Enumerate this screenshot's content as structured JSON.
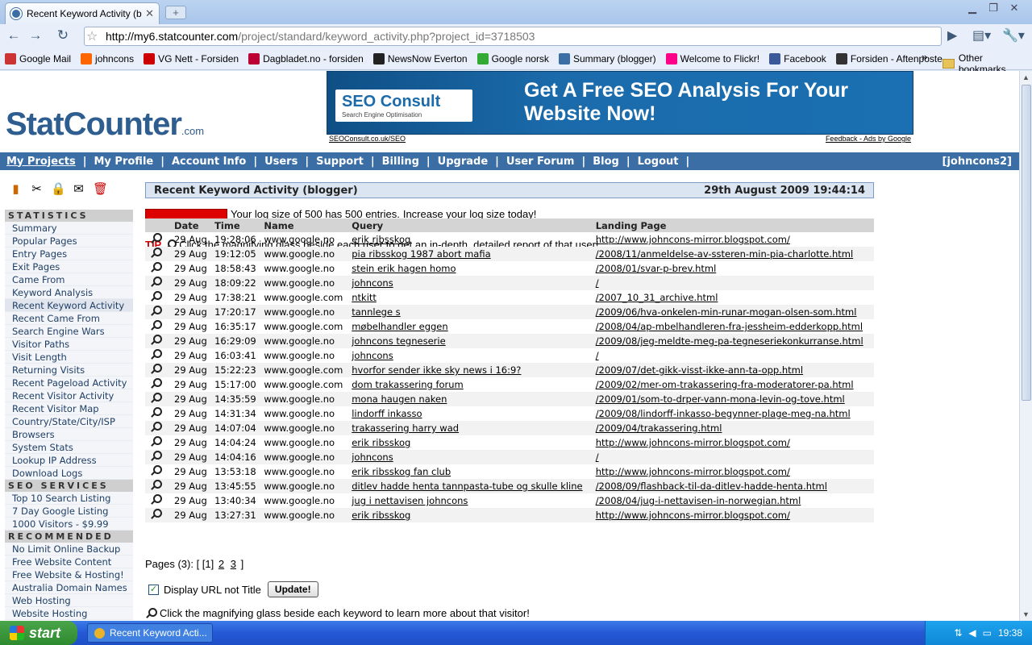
{
  "browser": {
    "tab_title": "Recent Keyword Activity (b...",
    "tab_close": "✕",
    "new_tab": "+",
    "url_host": "http://my6.statcounter.com",
    "url_rest": "/project/standard/keyword_activity.php?project_id=3718503",
    "bookmarks": [
      {
        "label": "Google Mail",
        "color": "#c33"
      },
      {
        "label": "johncons",
        "color": "#f60"
      },
      {
        "label": "VG Nett - Forsiden",
        "color": "#c00"
      },
      {
        "label": "Dagbladet.no - forsiden",
        "color": "#b03"
      },
      {
        "label": "NewsNow Everton",
        "color": "#222"
      },
      {
        "label": "Google norsk",
        "color": "#3a3"
      },
      {
        "label": "Summary (blogger)",
        "color": "#3a6ea5"
      },
      {
        "label": "Welcome to Flickr!",
        "color": "#f08"
      },
      {
        "label": "Facebook",
        "color": "#3b5998"
      },
      {
        "label": "Forsiden - Aftenposte...",
        "color": "#333"
      }
    ],
    "bookmarks_more": "»",
    "other_bookmarks": "Other bookmarks"
  },
  "site": {
    "logo_text": "StatCounter",
    "logo_suffix": ".com",
    "ad_title": "SEO Consult",
    "ad_subtitle": "Search Engine Optimisation",
    "ad_headline": "Get A Free SEO Analysis For Your Website Now!",
    "ad_url": "SEOConsult.co.uk/SEO",
    "ad_feedback": "Feedback - Ads by Google"
  },
  "nav": {
    "items": [
      "My Projects",
      "My Profile",
      "Account Info",
      "Users",
      "Support",
      "Billing",
      "Upgrade",
      "User Forum",
      "Blog",
      "Logout"
    ],
    "user": "[johncons2]"
  },
  "sidebar": {
    "statistics_header": "STATISTICS",
    "statistics": [
      "Summary",
      "Popular Pages",
      "Entry Pages",
      "Exit Pages",
      "Came From",
      "Keyword Analysis",
      "Recent Keyword Activity",
      "Recent Came From",
      "Search Engine Wars",
      "Visitor Paths",
      "Visit Length",
      "Returning Visits",
      "Recent Pageload Activity",
      "Recent Visitor Activity",
      "Recent Visitor Map",
      "Country/State/City/ISP",
      "Browsers",
      "System Stats",
      "Lookup IP Address",
      "Download Logs"
    ],
    "seo_header": "SEO SERVICES",
    "seo": [
      "Top 10 Search Listing",
      "7 Day Google Listing",
      "1000 Visitors - $9.99"
    ],
    "recommended_header": "RECOMMENDED",
    "recommended": [
      "No Limit Online Backup",
      "Free Website Content",
      "Free Website & Hosting!",
      "Australia Domain Names",
      "Web Hosting",
      "Website Hosting"
    ]
  },
  "main": {
    "title": "Recent Keyword Activity (blogger)",
    "datetime": "29th August 2009 19:44:14",
    "log_text": "Your log size of 500 has 500 entries.",
    "log_link": "Increase your log size today!",
    "tip_label": "TIP",
    "tip_text": "Click the magnifying glass beside each user to get an in-depth, detailed report of that user!",
    "columns": [
      "Date",
      "Time",
      "Name",
      "Query",
      "Landing Page"
    ],
    "rows": [
      {
        "date": "29 Aug",
        "time": "19:28:06",
        "name": "www.google.no",
        "query": "erik ribsskog",
        "page": "http://www.johncons-mirror.blogspot.com/"
      },
      {
        "date": "29 Aug",
        "time": "19:12:05",
        "name": "www.google.no",
        "query": "pia ribsskog 1987 abort mafia",
        "page": "/2008/11/anmeldelse-av-ssteren-min-pia-charlotte.html"
      },
      {
        "date": "29 Aug",
        "time": "18:58:43",
        "name": "www.google.no",
        "query": "stein erik hagen homo",
        "page": "/2008/01/svar-p-brev.html"
      },
      {
        "date": "29 Aug",
        "time": "18:09:22",
        "name": "www.google.no",
        "query": "johncons",
        "page": "/"
      },
      {
        "date": "29 Aug",
        "time": "17:38:21",
        "name": "www.google.com",
        "query": "ntkitt",
        "page": "/2007_10_31_archive.html"
      },
      {
        "date": "29 Aug",
        "time": "17:20:17",
        "name": "www.google.no",
        "query": "tannlege s",
        "page": "/2009/06/hva-onkelen-min-runar-mogan-olsen-som.html"
      },
      {
        "date": "29 Aug",
        "time": "16:35:17",
        "name": "www.google.com",
        "query": "møbelhandler eggen",
        "page": "/2008/04/ap-mbelhandleren-fra-jessheim-edderkopp.html"
      },
      {
        "date": "29 Aug",
        "time": "16:29:09",
        "name": "www.google.no",
        "query": "johncons tegneserie",
        "page": "/2009/08/jeg-meldte-meg-pa-tegneseriekonkurranse.html"
      },
      {
        "date": "29 Aug",
        "time": "16:03:41",
        "name": "www.google.no",
        "query": "johncons",
        "page": "/"
      },
      {
        "date": "29 Aug",
        "time": "15:22:23",
        "name": "www.google.com",
        "query": "hvorfor sender ikke sky news i 16:9?",
        "page": "/2009/07/det-gikk-visst-ikke-ann-ta-opp.html"
      },
      {
        "date": "29 Aug",
        "time": "15:17:00",
        "name": "www.google.com",
        "query": "dom trakassering forum",
        "page": "/2009/02/mer-om-trakassering-fra-moderatorer-pa.html"
      },
      {
        "date": "29 Aug",
        "time": "14:35:59",
        "name": "www.google.no",
        "query": "mona haugen naken",
        "page": "/2009/01/som-to-drper-vann-mona-levin-og-tove.html"
      },
      {
        "date": "29 Aug",
        "time": "14:31:34",
        "name": "www.google.no",
        "query": "lindorff inkasso",
        "page": "/2009/08/lindorff-inkasso-begynner-plage-meg-na.html"
      },
      {
        "date": "29 Aug",
        "time": "14:07:04",
        "name": "www.google.no",
        "query": "trakassering harry wad",
        "page": "/2009/04/trakassering.html"
      },
      {
        "date": "29 Aug",
        "time": "14:04:24",
        "name": "www.google.no",
        "query": "erik ribsskog",
        "page": "http://www.johncons-mirror.blogspot.com/"
      },
      {
        "date": "29 Aug",
        "time": "14:04:16",
        "name": "www.google.no",
        "query": "johncons",
        "page": "/"
      },
      {
        "date": "29 Aug",
        "time": "13:53:18",
        "name": "www.google.no",
        "query": "erik ribsskog fan club",
        "page": "http://www.johncons-mirror.blogspot.com/"
      },
      {
        "date": "29 Aug",
        "time": "13:45:55",
        "name": "www.google.no",
        "query": "ditlev hadde henta tannpasta-tube og skulle kline",
        "page": "/2008/09/flashback-til-da-ditlev-hadde-henta.html"
      },
      {
        "date": "29 Aug",
        "time": "13:40:34",
        "name": "www.google.no",
        "query": "jug i nettavisen johncons",
        "page": "/2008/04/jug-i-nettavisen-in-norwegian.html"
      },
      {
        "date": "29 Aug",
        "time": "13:27:31",
        "name": "www.google.no",
        "query": "erik ribsskog",
        "page": "http://www.johncons-mirror.blogspot.com/"
      }
    ],
    "pages_label": "Pages (3): [ [1]",
    "page2": "2",
    "page3": "3",
    "pages_end": "]",
    "display_url_label": "Display URL not Title",
    "display_url_checked": "✓",
    "update_button": "Update!",
    "footer_text": "Click the magnifying glass beside each keyword to learn more about that visitor!"
  },
  "taskbar": {
    "start": "start",
    "task_item": "Recent Keyword Acti...",
    "help": "?",
    "clock": "19:38"
  }
}
